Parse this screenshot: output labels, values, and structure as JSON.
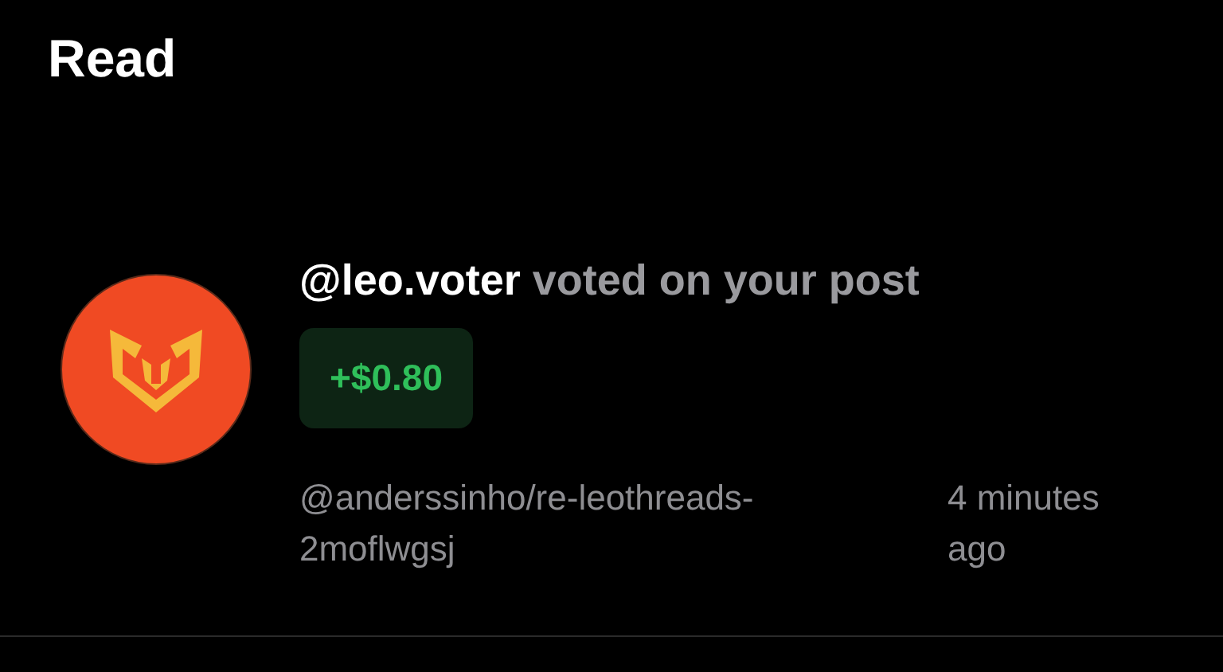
{
  "header": {
    "title": "Read"
  },
  "notifications": [
    {
      "user": "@leo.voter",
      "action": "voted on your post",
      "amount": "+$0.80",
      "permlink": "@anderssinho/re-leothreads-2moflwgsj",
      "time": "4 minutes ago"
    }
  ]
}
